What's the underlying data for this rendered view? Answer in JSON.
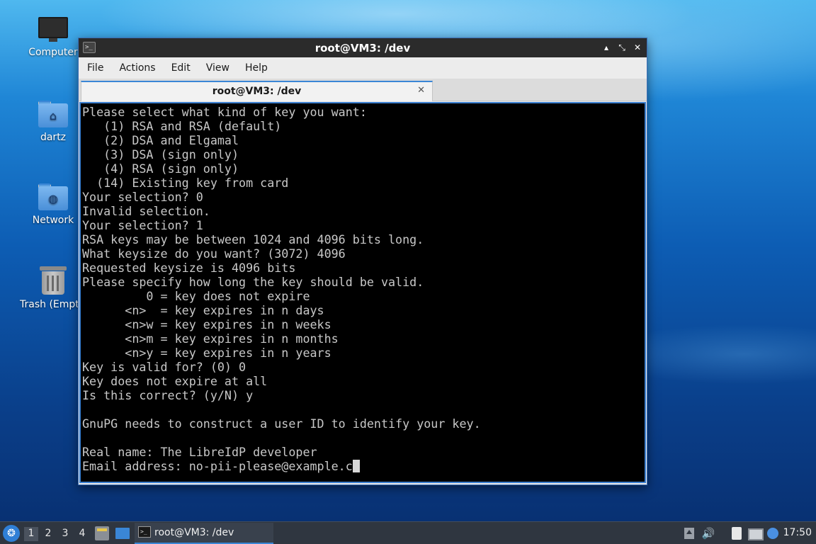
{
  "desktop": {
    "icons": [
      {
        "label": "Computer"
      },
      {
        "label": "dartz"
      },
      {
        "label": "Network"
      },
      {
        "label": "Trash (Empty)"
      }
    ]
  },
  "window": {
    "title": "root@VM3: /dev",
    "menu": [
      "File",
      "Actions",
      "Edit",
      "View",
      "Help"
    ],
    "tab_label": "root@VM3: /dev",
    "controls": {
      "minimize": "▴",
      "maximize": "⤡",
      "close": "✕"
    }
  },
  "terminal": {
    "lines": [
      "Please select what kind of key you want:",
      "   (1) RSA and RSA (default)",
      "   (2) DSA and Elgamal",
      "   (3) DSA (sign only)",
      "   (4) RSA (sign only)",
      "  (14) Existing key from card",
      "Your selection? 0",
      "Invalid selection.",
      "Your selection? 1",
      "RSA keys may be between 1024 and 4096 bits long.",
      "What keysize do you want? (3072) 4096",
      "Requested keysize is 4096 bits",
      "Please specify how long the key should be valid.",
      "         0 = key does not expire",
      "      <n>  = key expires in n days",
      "      <n>w = key expires in n weeks",
      "      <n>m = key expires in n months",
      "      <n>y = key expires in n years",
      "Key is valid for? (0) 0",
      "Key does not expire at all",
      "Is this correct? (y/N) y",
      "",
      "GnuPG needs to construct a user ID to identify your key.",
      "",
      "Real name: The LibreIdP developer",
      "Email address: no-pii-please@example.c"
    ]
  },
  "taskbar": {
    "workspaces": [
      "1",
      "2",
      "3",
      "4"
    ],
    "active_workspace": "1",
    "task_label": "root@VM3: /dev",
    "clock": "17:50",
    "accent": "#3a86d6"
  }
}
